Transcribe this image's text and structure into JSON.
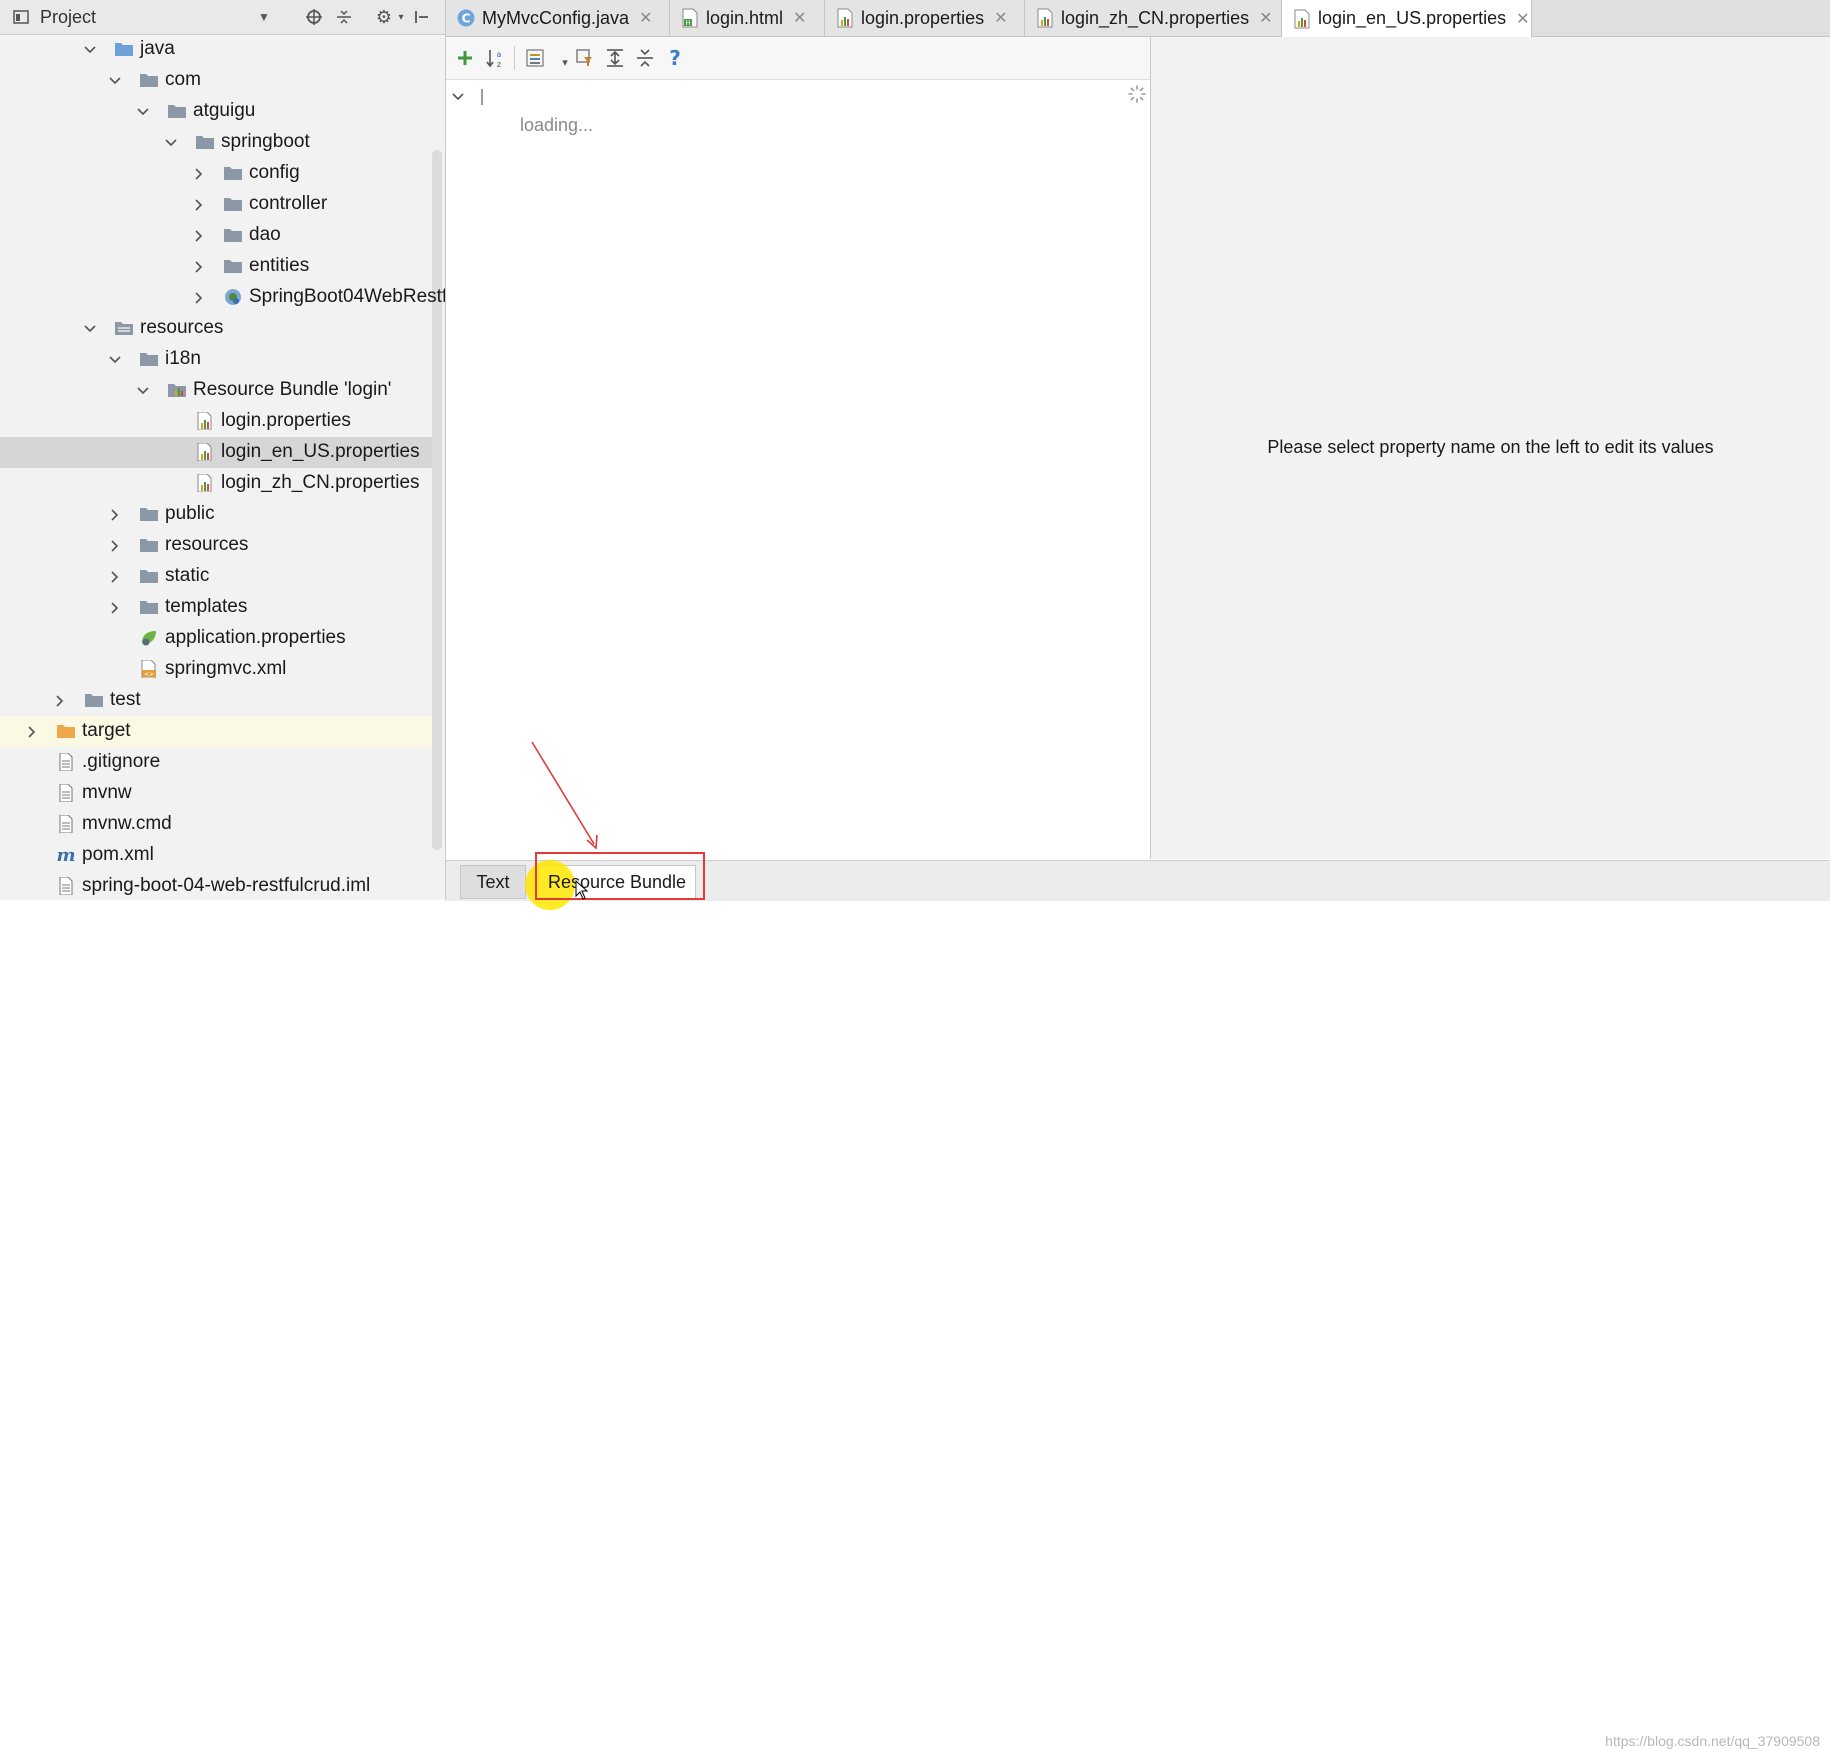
{
  "project_panel": {
    "title": "Project",
    "tree": [
      {
        "label": "java"
      },
      {
        "label": "com"
      },
      {
        "label": "atguigu"
      },
      {
        "label": "springboot"
      },
      {
        "label": "config"
      },
      {
        "label": "controller"
      },
      {
        "label": "dao"
      },
      {
        "label": "entities"
      },
      {
        "label": "SpringBoot04WebRestf"
      },
      {
        "label": "resources"
      },
      {
        "label": "i18n"
      },
      {
        "label": "Resource Bundle 'login'"
      },
      {
        "label": "login.properties"
      },
      {
        "label": "login_en_US.properties"
      },
      {
        "label": "login_zh_CN.properties"
      },
      {
        "label": "public"
      },
      {
        "label": "resources"
      },
      {
        "label": "static"
      },
      {
        "label": "templates"
      },
      {
        "label": "application.properties"
      },
      {
        "label": "springmvc.xml"
      },
      {
        "label": "test"
      },
      {
        "label": "target"
      },
      {
        "label": ".gitignore"
      },
      {
        "label": "mvnw"
      },
      {
        "label": "mvnw.cmd"
      },
      {
        "label": "pom.xml"
      },
      {
        "label": "spring-boot-04-web-restfulcrud.iml"
      }
    ]
  },
  "tabs": [
    {
      "label": "MyMvcConfig.java"
    },
    {
      "label": "login.html"
    },
    {
      "label": "login.properties"
    },
    {
      "label": "login_zh_CN.properties"
    },
    {
      "label": "login_en_US.properties"
    }
  ],
  "editor": {
    "loading_text": "loading...",
    "hint_text": "Please select property name on the left to edit its values"
  },
  "bottom_tabs": {
    "text_label": "Text",
    "bundle_label": "Resource Bundle"
  },
  "watermark": "https://blog.csdn.net/qq_37909508",
  "colors": {
    "folder": "#8c98a6",
    "java_folder": "#6fa0d6",
    "target_folder": "#f0a64a",
    "annotation_red": "#e23a3a",
    "cursor_highlight": "#ffe600"
  }
}
